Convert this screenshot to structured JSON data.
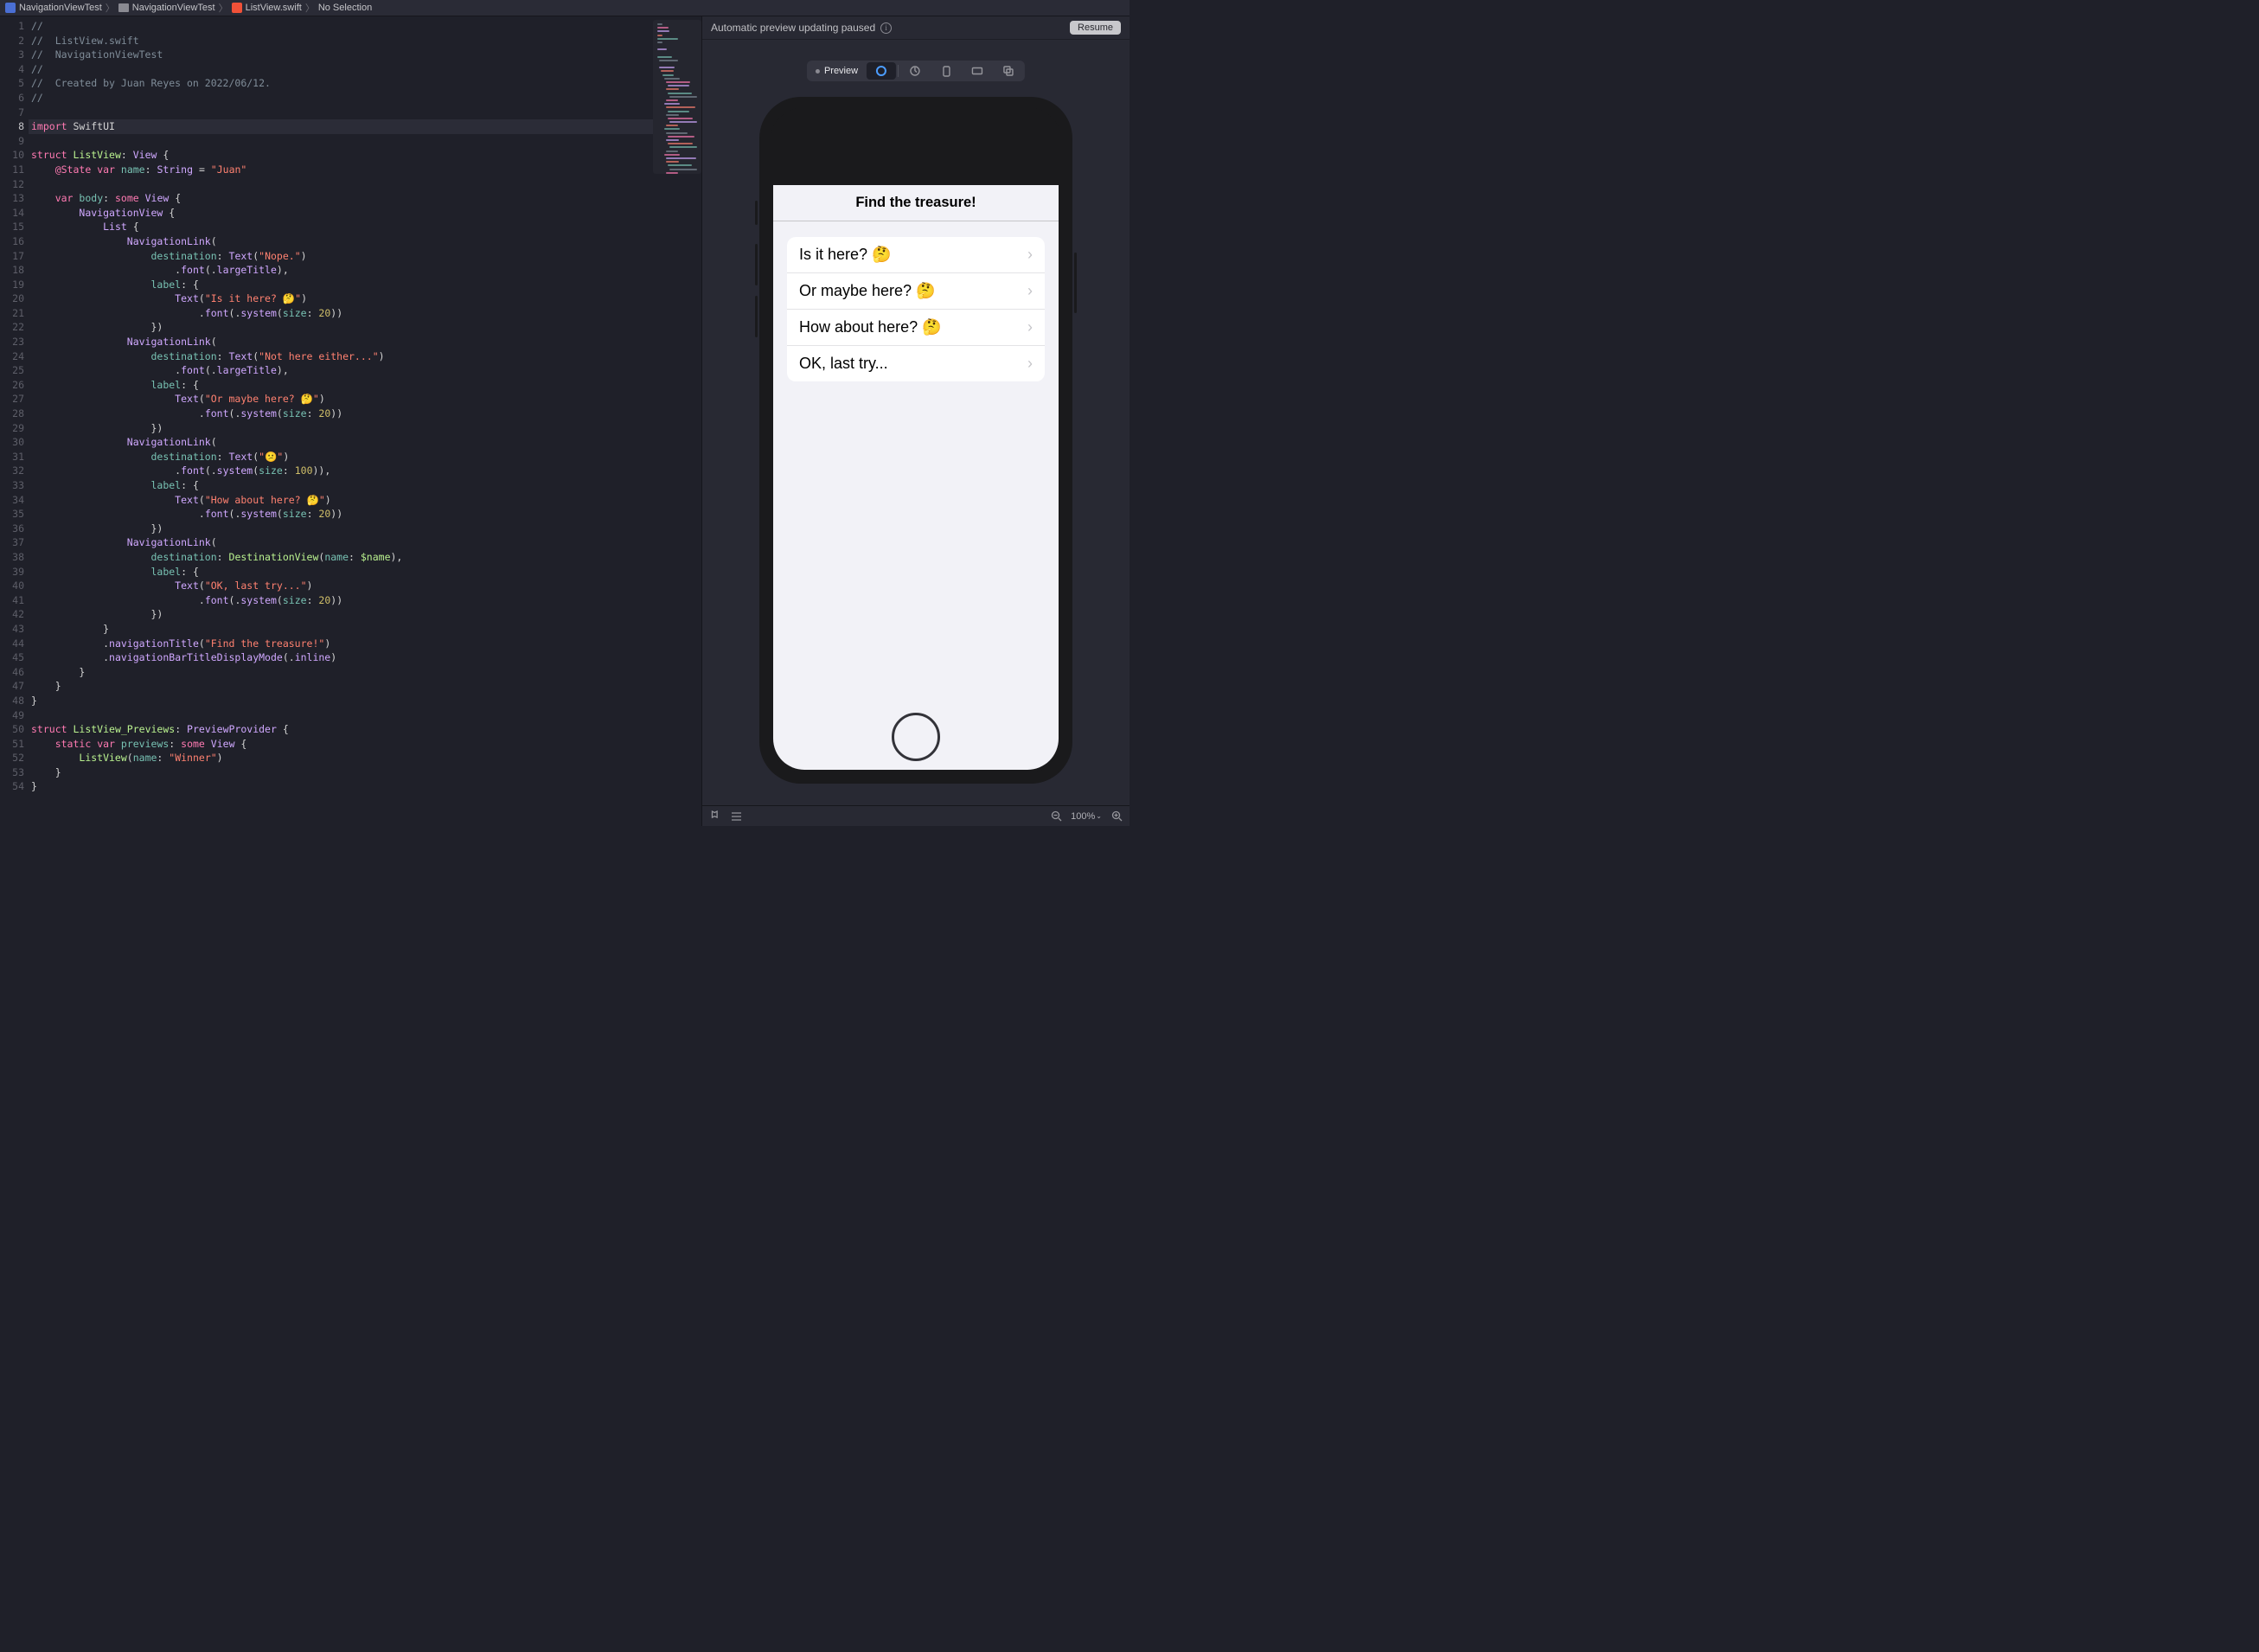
{
  "breadcrumb": {
    "project": "NavigationViewTest",
    "folder": "NavigationViewTest",
    "file": "ListView.swift",
    "selection": "No Selection"
  },
  "editor": {
    "current_line": 8,
    "lines": [
      {
        "n": 1,
        "html": "<span class='cmt'>//</span>"
      },
      {
        "n": 2,
        "html": "<span class='cmt'>//  ListView.swift</span>"
      },
      {
        "n": 3,
        "html": "<span class='cmt'>//  NavigationViewTest</span>"
      },
      {
        "n": 4,
        "html": "<span class='cmt'>//</span>"
      },
      {
        "n": 5,
        "html": "<span class='cmt'>//  Created by Juan Reyes on 2022/06/12.</span>"
      },
      {
        "n": 6,
        "html": "<span class='cmt'>//</span>"
      },
      {
        "n": 7,
        "html": ""
      },
      {
        "n": 8,
        "html": "<span class='kw'>import</span> <span class='ident'>SwiftUI</span>"
      },
      {
        "n": 9,
        "html": ""
      },
      {
        "n": 10,
        "html": "<span class='kw'>struct</span> <span class='mytype'>ListView</span><span class='plain'>: </span><span class='type'>View</span><span class='plain'> {</span>"
      },
      {
        "n": 11,
        "html": "    <span class='kw'>@State</span> <span class='kw'>var</span> <span class='prop'>name</span><span class='plain'>: </span><span class='type'>String</span><span class='plain'> = </span><span class='str'>\"Juan\"</span>"
      },
      {
        "n": 12,
        "html": "    "
      },
      {
        "n": 13,
        "html": "    <span class='kw'>var</span> <span class='prop'>body</span><span class='plain'>: </span><span class='kw'>some</span> <span class='type'>View</span><span class='plain'> {</span>"
      },
      {
        "n": 14,
        "html": "        <span class='type'>NavigationView</span><span class='plain'> {</span>"
      },
      {
        "n": 15,
        "html": "            <span class='type'>List</span><span class='plain'> {</span>"
      },
      {
        "n": 16,
        "html": "                <span class='type'>NavigationLink</span><span class='plain'>(</span>"
      },
      {
        "n": 17,
        "html": "                    <span class='argl'>destination</span><span class='plain'>: </span><span class='type'>Text</span><span class='plain'>(</span><span class='str'>\"Nope.\"</span><span class='plain'>)</span>"
      },
      {
        "n": 18,
        "html": "                        <span class='plain'>.</span><span class='fn'>font</span><span class='plain'>(.</span><span class='enumv'>largeTitle</span><span class='plain'>),</span>"
      },
      {
        "n": 19,
        "html": "                    <span class='argl'>label</span><span class='plain'>: {</span>"
      },
      {
        "n": 20,
        "html": "                        <span class='type'>Text</span><span class='plain'>(</span><span class='str'>\"Is it here? 🤔\"</span><span class='plain'>)</span>"
      },
      {
        "n": 21,
        "html": "                            <span class='plain'>.</span><span class='fn'>font</span><span class='plain'>(.</span><span class='fn'>system</span><span class='plain'>(</span><span class='argl'>size</span><span class='plain'>: </span><span class='num'>20</span><span class='plain'>))</span>"
      },
      {
        "n": 22,
        "html": "                    <span class='plain'>})</span>"
      },
      {
        "n": 23,
        "html": "                <span class='type'>NavigationLink</span><span class='plain'>(</span>"
      },
      {
        "n": 24,
        "html": "                    <span class='argl'>destination</span><span class='plain'>: </span><span class='type'>Text</span><span class='plain'>(</span><span class='str'>\"Not here either...\"</span><span class='plain'>)</span>"
      },
      {
        "n": 25,
        "html": "                        <span class='plain'>.</span><span class='fn'>font</span><span class='plain'>(.</span><span class='enumv'>largeTitle</span><span class='plain'>),</span>"
      },
      {
        "n": 26,
        "html": "                    <span class='argl'>label</span><span class='plain'>: {</span>"
      },
      {
        "n": 27,
        "html": "                        <span class='type'>Text</span><span class='plain'>(</span><span class='str'>\"Or maybe here? 🤔\"</span><span class='plain'>)</span>"
      },
      {
        "n": 28,
        "html": "                            <span class='plain'>.</span><span class='fn'>font</span><span class='plain'>(.</span><span class='fn'>system</span><span class='plain'>(</span><span class='argl'>size</span><span class='plain'>: </span><span class='num'>20</span><span class='plain'>))</span>"
      },
      {
        "n": 29,
        "html": "                    <span class='plain'>})</span>"
      },
      {
        "n": 30,
        "html": "                <span class='type'>NavigationLink</span><span class='plain'>(</span>"
      },
      {
        "n": 31,
        "html": "                    <span class='argl'>destination</span><span class='plain'>: </span><span class='type'>Text</span><span class='plain'>(</span><span class='str'>\"😕\"</span><span class='plain'>)</span>"
      },
      {
        "n": 32,
        "html": "                        <span class='plain'>.</span><span class='fn'>font</span><span class='plain'>(.</span><span class='fn'>system</span><span class='plain'>(</span><span class='argl'>size</span><span class='plain'>: </span><span class='num'>100</span><span class='plain'>)),</span>"
      },
      {
        "n": 33,
        "html": "                    <span class='argl'>label</span><span class='plain'>: {</span>"
      },
      {
        "n": 34,
        "html": "                        <span class='type'>Text</span><span class='plain'>(</span><span class='str'>\"How about here? 🤔\"</span><span class='plain'>)</span>"
      },
      {
        "n": 35,
        "html": "                            <span class='plain'>.</span><span class='fn'>font</span><span class='plain'>(.</span><span class='fn'>system</span><span class='plain'>(</span><span class='argl'>size</span><span class='plain'>: </span><span class='num'>20</span><span class='plain'>))</span>"
      },
      {
        "n": 36,
        "html": "                    <span class='plain'>})</span>"
      },
      {
        "n": 37,
        "html": "                <span class='type'>NavigationLink</span><span class='plain'>(</span>"
      },
      {
        "n": 38,
        "html": "                    <span class='argl'>destination</span><span class='plain'>: </span><span class='mytype'>DestinationView</span><span class='plain'>(</span><span class='argl'>name</span><span class='plain'>: </span><span class='myprop'>$name</span><span class='plain'>),</span>"
      },
      {
        "n": 39,
        "html": "                    <span class='argl'>label</span><span class='plain'>: {</span>"
      },
      {
        "n": 40,
        "html": "                        <span class='type'>Text</span><span class='plain'>(</span><span class='str'>\"OK, last try...\"</span><span class='plain'>)</span>"
      },
      {
        "n": 41,
        "html": "                            <span class='plain'>.</span><span class='fn'>font</span><span class='plain'>(.</span><span class='fn'>system</span><span class='plain'>(</span><span class='argl'>size</span><span class='plain'>: </span><span class='num'>20</span><span class='plain'>))</span>"
      },
      {
        "n": 42,
        "html": "                    <span class='plain'>})</span>"
      },
      {
        "n": 43,
        "html": "            <span class='plain'>}</span>"
      },
      {
        "n": 44,
        "html": "            <span class='plain'>.</span><span class='fn'>navigationTitle</span><span class='plain'>(</span><span class='str'>\"Find the treasure!\"</span><span class='plain'>)</span>"
      },
      {
        "n": 45,
        "html": "            <span class='plain'>.</span><span class='fn'>navigationBarTitleDisplayMode</span><span class='plain'>(.</span><span class='enumv'>inline</span><span class='plain'>)</span>"
      },
      {
        "n": 46,
        "html": "        <span class='plain'>}</span>"
      },
      {
        "n": 47,
        "html": "    <span class='plain'>}</span>"
      },
      {
        "n": 48,
        "html": "<span class='plain'>}</span>"
      },
      {
        "n": 49,
        "html": ""
      },
      {
        "n": 50,
        "html": "<span class='kw'>struct</span> <span class='mytype'>ListView_Previews</span><span class='plain'>: </span><span class='type'>PreviewProvider</span><span class='plain'> {</span>"
      },
      {
        "n": 51,
        "html": "    <span class='kw'>static</span> <span class='kw'>var</span> <span class='prop'>previews</span><span class='plain'>: </span><span class='kw'>some</span> <span class='type'>View</span><span class='plain'> {</span>"
      },
      {
        "n": 52,
        "html": "        <span class='mytype'>ListView</span><span class='plain'>(</span><span class='argl'>name</span><span class='plain'>: </span><span class='str'>\"Winner\"</span><span class='plain'>)</span>"
      },
      {
        "n": 53,
        "html": "    <span class='plain'>}</span>"
      },
      {
        "n": 54,
        "html": "<span class='plain'>}</span>"
      }
    ]
  },
  "preview": {
    "status_msg": "Automatic preview updating paused",
    "resume_label": "Resume",
    "segment_label": "Preview",
    "nav_title": "Find the treasure!",
    "list_items": [
      "Is it here? 🤔",
      "Or maybe here? 🤔",
      "How about here? 🤔",
      "OK, last try..."
    ],
    "zoom": "100%"
  }
}
